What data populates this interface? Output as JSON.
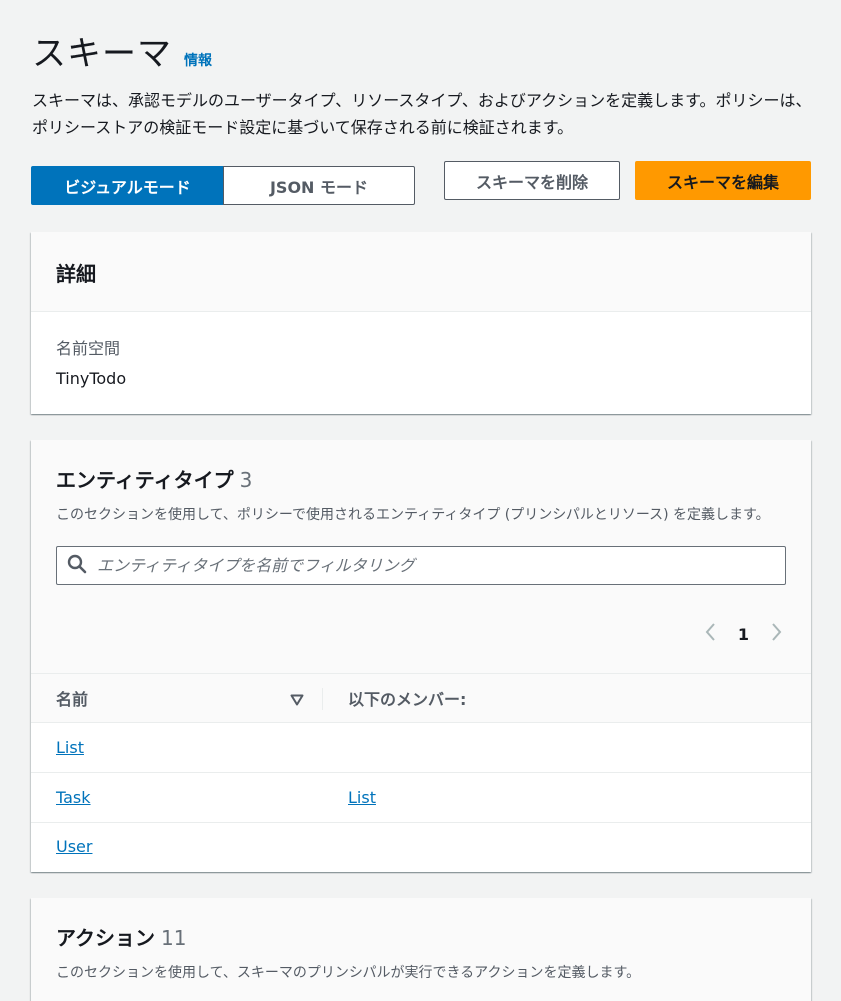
{
  "header": {
    "title": "スキーマ",
    "info_label": "情報",
    "description": "スキーマは、承認モデルのユーザータイプ、リソースタイプ、およびアクションを定義します。ポリシーは、ポリシーストアの検証モード設定に基づいて保存される前に検証されます。"
  },
  "mode_toggle": {
    "visual_label": "ビジュアルモード",
    "json_label": "JSON モード",
    "selected": "ビジュアルモード"
  },
  "toolbar": {
    "delete_label": "スキーマを削除",
    "edit_label": "スキーマを編集"
  },
  "details": {
    "title": "詳細",
    "namespace_label": "名前空間",
    "namespace_value": "TinyTodo"
  },
  "entity_types": {
    "title": "エンティティタイプ",
    "count": "3",
    "description": "このセクションを使用して、ポリシーで使用されるエンティティタイプ (プリンシパルとリソース) を定義します。",
    "filter_placeholder": "エンティティタイプを名前でフィルタリング",
    "page": "1",
    "columns": {
      "name": "名前",
      "member_of": "以下のメンバー:"
    },
    "rows": [
      {
        "name": "List",
        "member_of": ""
      },
      {
        "name": "Task",
        "member_of": "List"
      },
      {
        "name": "User",
        "member_of": ""
      }
    ]
  },
  "actions": {
    "title": "アクション",
    "count": "11",
    "description": "このセクションを使用して、スキーマのプリンシパルが実行できるアクションを定義します。"
  },
  "colors": {
    "primary": "#0073bb",
    "accent": "#ff9900",
    "background": "#f2f3f3"
  }
}
